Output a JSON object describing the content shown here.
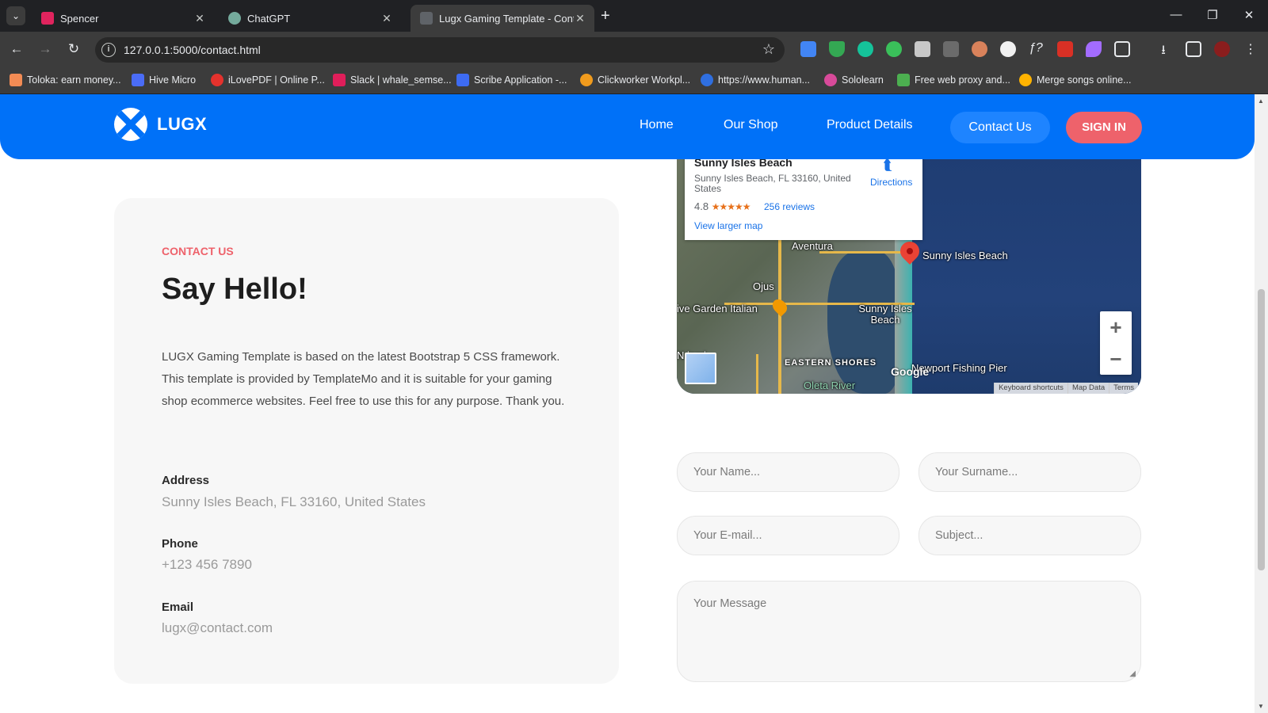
{
  "browser": {
    "tabs": [
      {
        "title": "Spencer",
        "favicon_color": "#e0245e"
      },
      {
        "title": "ChatGPT",
        "favicon_color": "#74aa9c"
      },
      {
        "title": "Lugx Gaming Template - Conta",
        "favicon_color": "#5f6368"
      }
    ],
    "url": "127.0.0.1:5000/contact.html",
    "bookmarks": [
      {
        "label": "Toloka: earn money...",
        "color": "#f28b54"
      },
      {
        "label": "Hive Micro",
        "color": "#4a6cf7"
      },
      {
        "label": "iLovePDF | Online P...",
        "color": "#e5322d"
      },
      {
        "label": "Slack | whale_semse...",
        "color": "#e01e5a"
      },
      {
        "label": "Scribe Application -...",
        "color": "#3d6bf2"
      },
      {
        "label": "Clickworker Workpl...",
        "color": "#f09b1d"
      },
      {
        "label": "https://www.human...",
        "color": "#2f6fe0"
      },
      {
        "label": "Sololearn",
        "color": "#d84a9a"
      },
      {
        "label": "Free web proxy and...",
        "color": "#4caf50"
      },
      {
        "label": "Merge songs online...",
        "color": "#ffb300"
      }
    ]
  },
  "header": {
    "logo_text": "LUGX",
    "nav": [
      "Home",
      "Our Shop",
      "Product Details",
      "Contact Us"
    ],
    "signin_label": "SIGN IN",
    "accent": "#0071f8",
    "signin_color": "#ee626b"
  },
  "contact": {
    "tag": "CONTACT US",
    "title": "Say Hello!",
    "text": "LUGX Gaming Template is based on the latest Bootstrap 5 CSS framework. This template is provided by TemplateMo and it is suitable for your gaming shop ecommerce websites. Feel free to use this for any purpose. Thank you.",
    "address_label": "Address",
    "address_value": "Sunny Isles Beach, FL 33160, United States",
    "phone_label": "Phone",
    "phone_value": "+123 456 7890",
    "email_label": "Email",
    "email_value": "lugx@contact.com"
  },
  "map": {
    "place": "Sunny Isles Beach",
    "address": "Sunny Isles Beach, FL 33160, United States",
    "rating": "4.8",
    "stars": "★★★★★",
    "reviews": "256 reviews",
    "directions": "Directions",
    "view_larger": "View larger map",
    "labels": {
      "aventura": "Aventura",
      "sunny_isles_pin": "Sunny Isles Beach",
      "ojus": "Ojus",
      "olive_garden": "ive Garden Italian",
      "sunny_isles_2": "Sunny Isles Beach",
      "miami": "N    iami",
      "eastern_shores": "EASTERN SHORES",
      "newport": "Newport Fishing Pier",
      "oleta": "Oleta River",
      "google": "Google"
    },
    "footer": [
      "Keyboard shortcuts",
      "Map Data",
      "Terms"
    ]
  },
  "form": {
    "name_placeholder": "Your Name...",
    "surname_placeholder": "Your Surname...",
    "email_placeholder": "Your E-mail...",
    "subject_placeholder": "Subject...",
    "message_placeholder": "Your Message"
  }
}
